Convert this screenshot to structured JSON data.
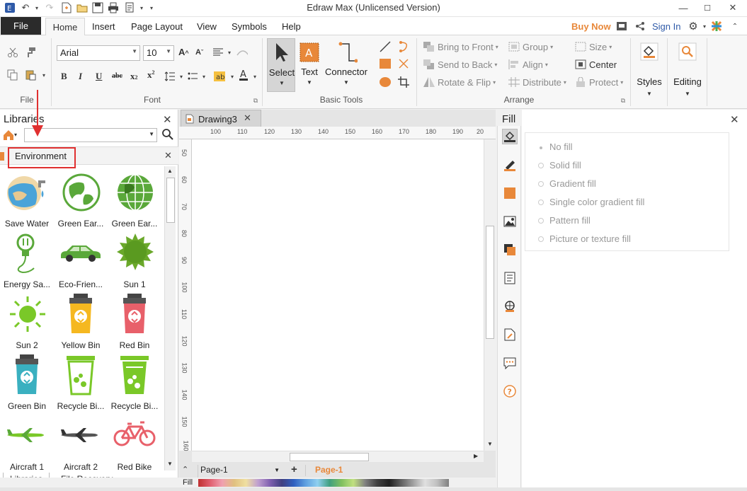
{
  "window": {
    "title": "Edraw Max (Unlicensed Version)"
  },
  "menu": {
    "tabs": [
      "File",
      "Home",
      "Insert",
      "Page Layout",
      "View",
      "Symbols",
      "Help"
    ],
    "buy_now": "Buy Now",
    "sign_in": "Sign In"
  },
  "ribbon": {
    "font_name": "Arial",
    "font_size": "10",
    "groups": {
      "file": "File",
      "font": "Font",
      "basic_tools": "Basic Tools",
      "arrange": "Arrange"
    },
    "basic_tools": {
      "select": "Select",
      "text": "Text",
      "connector": "Connector"
    },
    "arrange": {
      "bring_to_front": "Bring to Front",
      "send_to_back": "Send to Back",
      "rotate_flip": "Rotate & Flip",
      "group": "Group",
      "align": "Align",
      "distribute": "Distribute",
      "size": "Size",
      "center": "Center",
      "protect": "Protect"
    },
    "styles": "Styles",
    "editing": "Editing"
  },
  "libraries": {
    "title": "Libraries",
    "category": "Environment",
    "items": [
      {
        "label": "Save Water",
        "icon": "save-water-icon"
      },
      {
        "label": "Green Ear...",
        "icon": "green-earth-icon"
      },
      {
        "label": "Green Ear...",
        "icon": "green-earth-grid-icon"
      },
      {
        "label": "Energy Sa...",
        "icon": "energy-saving-icon"
      },
      {
        "label": "Eco-Frien...",
        "icon": "eco-car-icon"
      },
      {
        "label": "Sun 1",
        "icon": "sun-1-icon"
      },
      {
        "label": "Sun 2",
        "icon": "sun-2-icon"
      },
      {
        "label": "Yellow Bin",
        "icon": "yellow-bin-icon"
      },
      {
        "label": "Red Bin",
        "icon": "red-bin-icon"
      },
      {
        "label": "Green Bin",
        "icon": "green-bin-icon"
      },
      {
        "label": "Recycle Bi...",
        "icon": "recycle-bin-outline-icon"
      },
      {
        "label": "Recycle Bi...",
        "icon": "recycle-bin-solid-icon"
      },
      {
        "label": "Aircraft 1",
        "icon": "aircraft-1-icon"
      },
      {
        "label": "Aircraft 2",
        "icon": "aircraft-2-icon"
      },
      {
        "label": "Red Bike",
        "icon": "red-bike-icon"
      }
    ],
    "bottom_tabs": [
      "Libraries",
      "File Recovery"
    ]
  },
  "document": {
    "tab": "Drawing3",
    "ruler_top": [
      "100",
      "110",
      "120",
      "130",
      "140",
      "150",
      "160",
      "170",
      "180",
      "190",
      "20"
    ],
    "ruler_left": [
      "50",
      "60",
      "70",
      "80",
      "90",
      "100",
      "110",
      "120",
      "130",
      "140",
      "150",
      "160"
    ],
    "page_selector": "Page-1",
    "active_page": "Page-1",
    "fill_label": "Fill"
  },
  "fill_panel": {
    "title": "Fill",
    "options": [
      "No fill",
      "Solid fill",
      "Gradient fill",
      "Single color gradient fill",
      "Pattern fill",
      "Picture or texture fill"
    ]
  },
  "colors": {
    "accent_orange": "#e8883a",
    "file_tab_bg": "#2b2b2b",
    "highlight_red": "#e03030",
    "select_bg": "#d5d5d5"
  }
}
